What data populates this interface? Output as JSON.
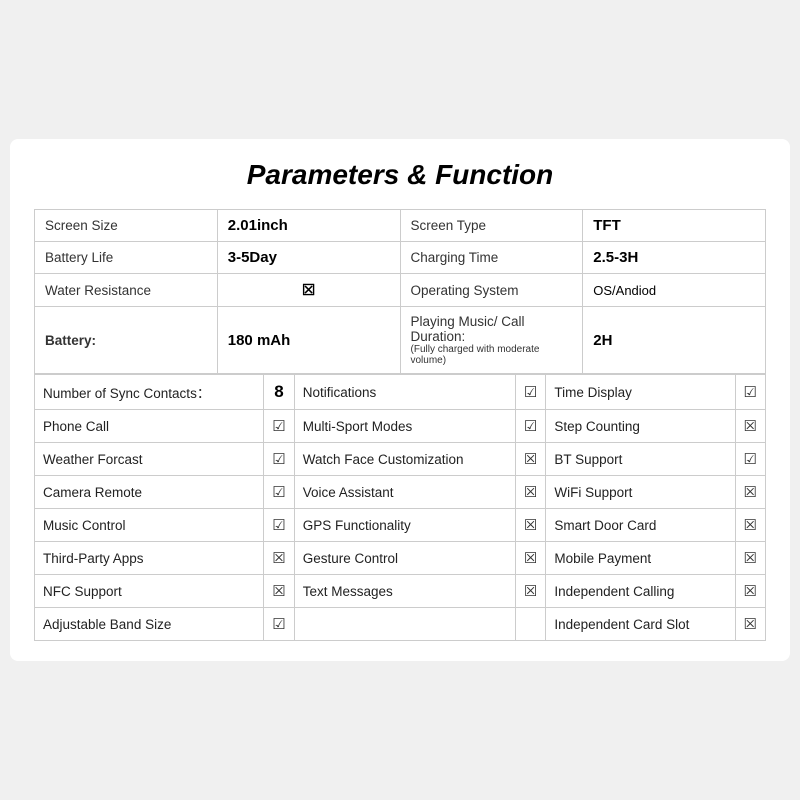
{
  "title": "Parameters & Function",
  "specs": [
    {
      "left_label": "Screen Size",
      "left_value": "2.01inch",
      "right_label": "Screen Type",
      "right_value": "TFT"
    },
    {
      "left_label": "Battery Life",
      "left_value": "3-5Day",
      "right_label": "Charging Time",
      "right_value": "2.5-3H"
    },
    {
      "left_label": "Water Resistance",
      "left_value": "☒",
      "left_value_type": "icon",
      "right_label": "Operating System",
      "right_value": "OS/Andiod"
    },
    {
      "left_label": "Battery:",
      "left_label_bold": true,
      "left_value": "180 mAh",
      "right_label": "Playing Music/ Call Duration:",
      "right_note": "(Fully charged with moderate volume)",
      "right_value": "2H"
    }
  ],
  "features_header": {
    "col1_label": "Number of Sync Contacts：",
    "col1_value": "8",
    "col2_label": "Notifications",
    "col2_check": "yes",
    "col3_label": "Time Display",
    "col3_check": "yes"
  },
  "features": [
    {
      "col1_label": "Phone Call",
      "col1_check": "yes",
      "col2_label": "Multi-Sport Modes",
      "col2_check": "yes",
      "col3_label": "Step Counting",
      "col3_check": "no"
    },
    {
      "col1_label": "Weather Forcast",
      "col1_check": "yes",
      "col2_label": "Watch Face Customization",
      "col2_check": "no",
      "col3_label": "BT Support",
      "col3_check": "yes"
    },
    {
      "col1_label": "Camera Remote",
      "col1_check": "yes",
      "col2_label": "Voice Assistant",
      "col2_check": "no",
      "col3_label": "WiFi Support",
      "col3_check": "no"
    },
    {
      "col1_label": "Music Control",
      "col1_check": "yes",
      "col2_label": "GPS Functionality",
      "col2_check": "no",
      "col3_label": "Smart Door Card",
      "col3_check": "no"
    },
    {
      "col1_label": "Third-Party Apps",
      "col1_check": "no",
      "col2_label": "Gesture Control",
      "col2_check": "no",
      "col3_label": "Mobile Payment",
      "col3_check": "no"
    },
    {
      "col1_label": "NFC Support",
      "col1_check": "no",
      "col2_label": "Text Messages",
      "col2_check": "no",
      "col3_label": "Independent Calling",
      "col3_check": "no"
    },
    {
      "col1_label": "Adjustable Band Size",
      "col1_check": "yes",
      "col2_label": "",
      "col3_label": "Independent Card Slot",
      "col3_check": "no"
    }
  ],
  "icons": {
    "check_yes": "☑",
    "check_no": "☒"
  }
}
